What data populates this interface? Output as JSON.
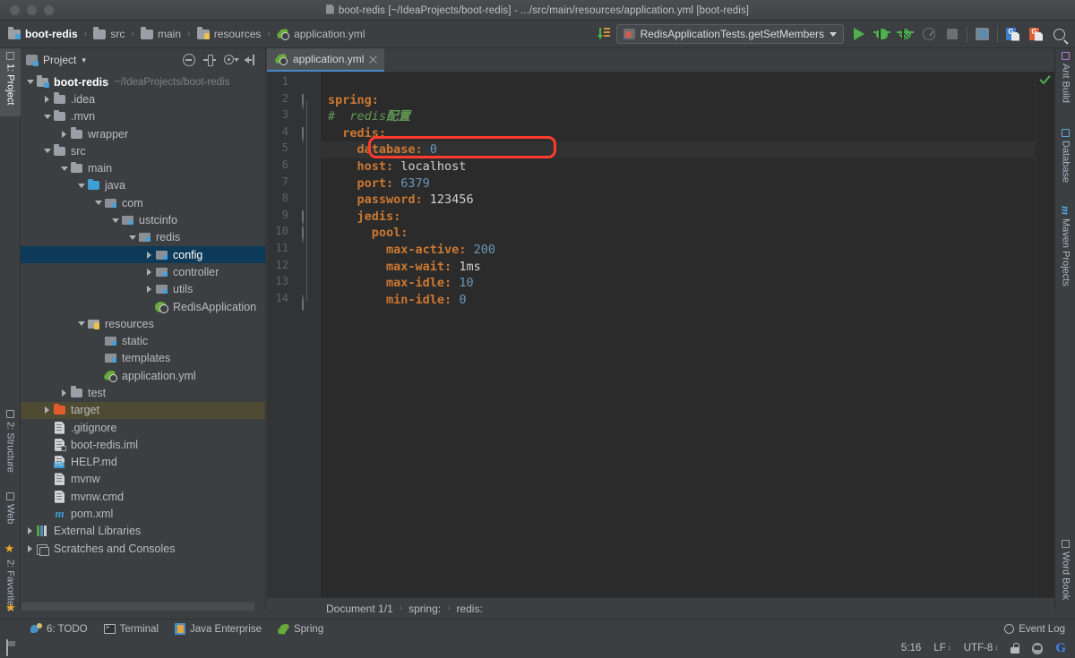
{
  "window": {
    "title": "boot-redis [~/IdeaProjects/boot-redis] - .../src/main/resources/application.yml [boot-redis]"
  },
  "navbar": {
    "crumbs": [
      {
        "label": "boot-redis",
        "icon": "module-folder-icon",
        "active": true
      },
      {
        "label": "src",
        "icon": "folder-icon",
        "active": false
      },
      {
        "label": "main",
        "icon": "folder-icon",
        "active": false
      },
      {
        "label": "resources",
        "icon": "resources-folder-icon",
        "active": false
      },
      {
        "label": "application.yml",
        "icon": "yaml-spring-icon",
        "active": false
      }
    ],
    "separator": "›"
  },
  "toolbar": {
    "update_project_label": "update-project-icon",
    "run_config": "RedisApplicationTests.getSetMembers",
    "buttons": [
      {
        "name": "run-button",
        "icon": "play-icon"
      },
      {
        "name": "debug-button",
        "icon": "bug-icon"
      },
      {
        "name": "run-coverage-button",
        "icon": "coverage-icon"
      },
      {
        "name": "profile-button",
        "icon": "gauge-icon"
      },
      {
        "name": "stop-button",
        "icon": "stop-icon"
      },
      {
        "name": "layout-button",
        "icon": "layout-icon"
      },
      {
        "name": "google-docs-blue-button",
        "icon": "gdoc-blue-icon"
      },
      {
        "name": "google-docs-red-button",
        "icon": "gdoc-red-icon"
      },
      {
        "name": "search-everywhere-button",
        "icon": "search-icon"
      }
    ]
  },
  "left_strip": [
    {
      "label": "1: Project",
      "selected": true,
      "icon": "project-icon"
    },
    {
      "label": "2: Structure",
      "selected": false,
      "icon": "structure-icon"
    },
    {
      "label": "Web",
      "selected": false,
      "icon": "web-icon"
    },
    {
      "label": "2: Favorites",
      "selected": false,
      "icon": "favorites-star-icon"
    }
  ],
  "right_strip": [
    {
      "label": "Ant Build",
      "icon": "ant-icon"
    },
    {
      "label": "Database",
      "icon": "database-icon"
    },
    {
      "label": "Maven Projects",
      "icon": "maven-m-icon"
    },
    {
      "label": "Word Book",
      "icon": "wordbook-icon"
    }
  ],
  "project_panel": {
    "title": "Project",
    "dropdown_caret": "▾",
    "actions": [
      {
        "name": "collapse-all-button",
        "icon": "collapse-all-icon"
      },
      {
        "name": "scroll-to-source-button",
        "icon": "target-icon"
      },
      {
        "name": "settings-button",
        "icon": "gear-icon"
      },
      {
        "name": "hide-panel-button",
        "icon": "hide-icon"
      }
    ],
    "tree": [
      {
        "label": "boot-redis",
        "sub": "~/IdeaProjects/boot-redis",
        "indent": 0,
        "arrow": "down",
        "icon": "module-folder-icon",
        "bold": true,
        "state": "none"
      },
      {
        "label": ".idea",
        "sub": "",
        "indent": 1,
        "arrow": "right",
        "icon": "folder-icon",
        "bold": false,
        "state": "none"
      },
      {
        "label": ".mvn",
        "sub": "",
        "indent": 1,
        "arrow": "down",
        "icon": "folder-icon",
        "bold": false,
        "state": "none"
      },
      {
        "label": "wrapper",
        "sub": "",
        "indent": 2,
        "arrow": "right",
        "icon": "folder-icon",
        "bold": false,
        "state": "none"
      },
      {
        "label": "src",
        "sub": "",
        "indent": 1,
        "arrow": "down",
        "icon": "folder-icon",
        "bold": false,
        "state": "none"
      },
      {
        "label": "main",
        "sub": "",
        "indent": 2,
        "arrow": "down",
        "icon": "folder-icon",
        "bold": false,
        "state": "none"
      },
      {
        "label": "java",
        "sub": "",
        "indent": 3,
        "arrow": "down",
        "icon": "source-folder-icon",
        "bold": false,
        "state": "none"
      },
      {
        "label": "com",
        "sub": "",
        "indent": 4,
        "arrow": "down",
        "icon": "package-icon",
        "bold": false,
        "state": "none"
      },
      {
        "label": "ustcinfo",
        "sub": "",
        "indent": 5,
        "arrow": "down",
        "icon": "package-icon",
        "bold": false,
        "state": "none"
      },
      {
        "label": "redis",
        "sub": "",
        "indent": 6,
        "arrow": "down",
        "icon": "package-icon",
        "bold": false,
        "state": "none"
      },
      {
        "label": "config",
        "sub": "",
        "indent": 7,
        "arrow": "right",
        "icon": "package-icon",
        "bold": false,
        "state": "selected"
      },
      {
        "label": "controller",
        "sub": "",
        "indent": 7,
        "arrow": "right",
        "icon": "package-icon",
        "bold": false,
        "state": "none"
      },
      {
        "label": "utils",
        "sub": "",
        "indent": 7,
        "arrow": "right",
        "icon": "package-icon",
        "bold": false,
        "state": "none"
      },
      {
        "label": "RedisApplication",
        "sub": "",
        "indent": 7,
        "arrow": "none",
        "icon": "spring-class-icon",
        "bold": false,
        "state": "none"
      },
      {
        "label": "resources",
        "sub": "",
        "indent": 3,
        "arrow": "down",
        "icon": "resources-folder-icon",
        "bold": false,
        "state": "none"
      },
      {
        "label": "static",
        "sub": "",
        "indent": 4,
        "arrow": "none",
        "icon": "package-icon",
        "bold": false,
        "state": "none"
      },
      {
        "label": "templates",
        "sub": "",
        "indent": 4,
        "arrow": "none",
        "icon": "package-icon",
        "bold": false,
        "state": "none"
      },
      {
        "label": "application.yml",
        "sub": "",
        "indent": 4,
        "arrow": "none",
        "icon": "yaml-spring-icon",
        "bold": false,
        "state": "none"
      },
      {
        "label": "test",
        "sub": "",
        "indent": 2,
        "arrow": "right",
        "icon": "folder-icon",
        "bold": false,
        "state": "none"
      },
      {
        "label": "target",
        "sub": "",
        "indent": 1,
        "arrow": "right",
        "icon": "target-folder-icon",
        "bold": false,
        "state": "hover"
      },
      {
        "label": ".gitignore",
        "sub": "",
        "indent": 1,
        "arrow": "none",
        "icon": "file-icon",
        "bold": false,
        "state": "none"
      },
      {
        "label": "boot-redis.iml",
        "sub": "",
        "indent": 1,
        "arrow": "none",
        "icon": "iml-file-icon",
        "bold": false,
        "state": "none"
      },
      {
        "label": "HELP.md",
        "sub": "",
        "indent": 1,
        "arrow": "none",
        "icon": "markdown-file-icon",
        "bold": false,
        "state": "none"
      },
      {
        "label": "mvnw",
        "sub": "",
        "indent": 1,
        "arrow": "none",
        "icon": "file-icon",
        "bold": false,
        "state": "none"
      },
      {
        "label": "mvnw.cmd",
        "sub": "",
        "indent": 1,
        "arrow": "none",
        "icon": "file-icon",
        "bold": false,
        "state": "none"
      },
      {
        "label": "pom.xml",
        "sub": "",
        "indent": 1,
        "arrow": "none",
        "icon": "maven-xml-icon",
        "bold": false,
        "state": "none"
      },
      {
        "label": "External Libraries",
        "sub": "",
        "indent": 0,
        "arrow": "right",
        "icon": "external-libraries-icon",
        "bold": false,
        "state": "none"
      },
      {
        "label": "Scratches and Consoles",
        "sub": "",
        "indent": 0,
        "arrow": "right",
        "icon": "scratches-icon",
        "bold": false,
        "state": "none"
      }
    ]
  },
  "editor": {
    "tab": {
      "label": "application.yml",
      "icon": "yaml-spring-icon",
      "close": "close-icon"
    },
    "inspection_status": "ok-checkmark",
    "lines": [
      {
        "n": 1,
        "indent": 0,
        "tokens": []
      },
      {
        "n": 2,
        "indent": 0,
        "tokens": [
          {
            "t": "spring:",
            "c": "k"
          }
        ]
      },
      {
        "n": 3,
        "indent": 0,
        "tokens": [
          {
            "t": "# ",
            "c": "cm"
          },
          {
            "t": " redis",
            "c": "cm"
          },
          {
            "t": "配置",
            "c": "cm-cn"
          }
        ]
      },
      {
        "n": 4,
        "indent": 1,
        "tokens": [
          {
            "t": "redis:",
            "c": "k"
          }
        ]
      },
      {
        "n": 5,
        "indent": 2,
        "tokens": [
          {
            "t": "database:",
            "c": "k"
          },
          {
            "t": " ",
            "c": "str"
          },
          {
            "t": "0",
            "c": "num"
          }
        ]
      },
      {
        "n": 6,
        "indent": 2,
        "tokens": [
          {
            "t": "host:",
            "c": "k"
          },
          {
            "t": " localhost",
            "c": "str"
          }
        ]
      },
      {
        "n": 7,
        "indent": 2,
        "tokens": [
          {
            "t": "port:",
            "c": "k"
          },
          {
            "t": " ",
            "c": "str"
          },
          {
            "t": "6379",
            "c": "num"
          }
        ]
      },
      {
        "n": 8,
        "indent": 2,
        "tokens": [
          {
            "t": "password:",
            "c": "k"
          },
          {
            "t": " 123456",
            "c": "str"
          }
        ]
      },
      {
        "n": 9,
        "indent": 2,
        "tokens": [
          {
            "t": "jedis:",
            "c": "k"
          }
        ]
      },
      {
        "n": 10,
        "indent": 3,
        "tokens": [
          {
            "t": "pool:",
            "c": "k"
          }
        ]
      },
      {
        "n": 11,
        "indent": 4,
        "tokens": [
          {
            "t": "max-active:",
            "c": "k"
          },
          {
            "t": " ",
            "c": "str"
          },
          {
            "t": "200",
            "c": "num"
          }
        ]
      },
      {
        "n": 12,
        "indent": 4,
        "tokens": [
          {
            "t": "max-wait:",
            "c": "k"
          },
          {
            "t": " 1ms",
            "c": "str"
          }
        ]
      },
      {
        "n": 13,
        "indent": 4,
        "tokens": [
          {
            "t": "max-idle:",
            "c": "k"
          },
          {
            "t": " ",
            "c": "str"
          },
          {
            "t": "10",
            "c": "num"
          }
        ]
      },
      {
        "n": 14,
        "indent": 4,
        "tokens": [
          {
            "t": "min-idle:",
            "c": "k"
          },
          {
            "t": " ",
            "c": "str"
          },
          {
            "t": "0",
            "c": "num"
          }
        ]
      }
    ],
    "fold_lines": [
      2,
      4,
      9,
      10
    ],
    "fold_end_line": 14,
    "annotation": {
      "line": 5,
      "color": "#ff3b30",
      "shape": "rounded-rect"
    },
    "current_line": 5
  },
  "bottom_breadcrumb": {
    "items": [
      "Document 1/1",
      "spring:",
      "redis:"
    ],
    "separator": "›"
  },
  "tool_windows": [
    {
      "label": "6: TODO",
      "prefix": "6",
      "icon": "todo-icon"
    },
    {
      "label": "Terminal",
      "prefix": "",
      "icon": "terminal-icon"
    },
    {
      "label": "Java Enterprise",
      "prefix": "",
      "icon": "java-enterprise-icon"
    },
    {
      "label": "Spring",
      "prefix": "",
      "icon": "spring-leaf-icon"
    }
  ],
  "event_log": {
    "label": "Event Log",
    "icon": "event-log-icon"
  },
  "statusbar": {
    "caret_position": "5:16",
    "line_separator": "LF",
    "encoding": "UTF-8",
    "lock": "read-write-lock-icon",
    "tux": "linux-icon",
    "google": "G"
  },
  "colors": {
    "accent": "#4a88c7",
    "selection": "#0d3a58",
    "annotation": "#ff3b30",
    "key": "#cc7832",
    "number": "#6897bb",
    "comment": "#629755",
    "editor_bg": "#2b2b2b",
    "panel_bg": "#3c3f41"
  }
}
